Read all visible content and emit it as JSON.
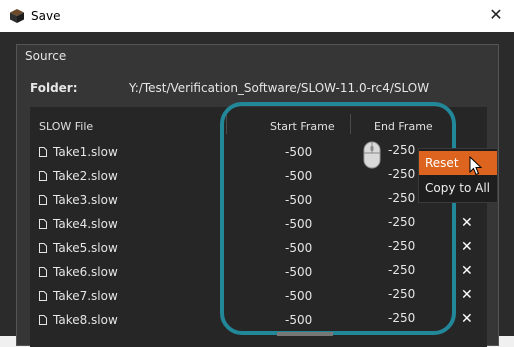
{
  "window": {
    "title": "Save"
  },
  "source": {
    "title": "Source",
    "folder_label": "Folder:",
    "folder_path": "Y:/Test/Verification_Software/SLOW-11.0-rc4/SLOW"
  },
  "table": {
    "headers": {
      "file": "SLOW File",
      "start": "Start Frame",
      "end": "End Frame"
    },
    "rows": [
      {
        "file": "Take1.slow",
        "start": "-500",
        "end": "-250"
      },
      {
        "file": "Take2.slow",
        "start": "-500",
        "end": "-250"
      },
      {
        "file": "Take3.slow",
        "start": "-500",
        "end": "-250"
      },
      {
        "file": "Take4.slow",
        "start": "-500",
        "end": "-250"
      },
      {
        "file": "Take5.slow",
        "start": "-500",
        "end": "-250"
      },
      {
        "file": "Take6.slow",
        "start": "-500",
        "end": "-250"
      },
      {
        "file": "Take7.slow",
        "start": "-500",
        "end": "-250"
      },
      {
        "file": "Take8.slow",
        "start": "-500",
        "end": "-250"
      }
    ],
    "remove_icon": "✕"
  },
  "context_menu": {
    "items": [
      {
        "label": "Reset"
      },
      {
        "label": "Copy to All"
      }
    ]
  },
  "colors": {
    "accent": "#dc641e",
    "highlight": "#23879a"
  }
}
